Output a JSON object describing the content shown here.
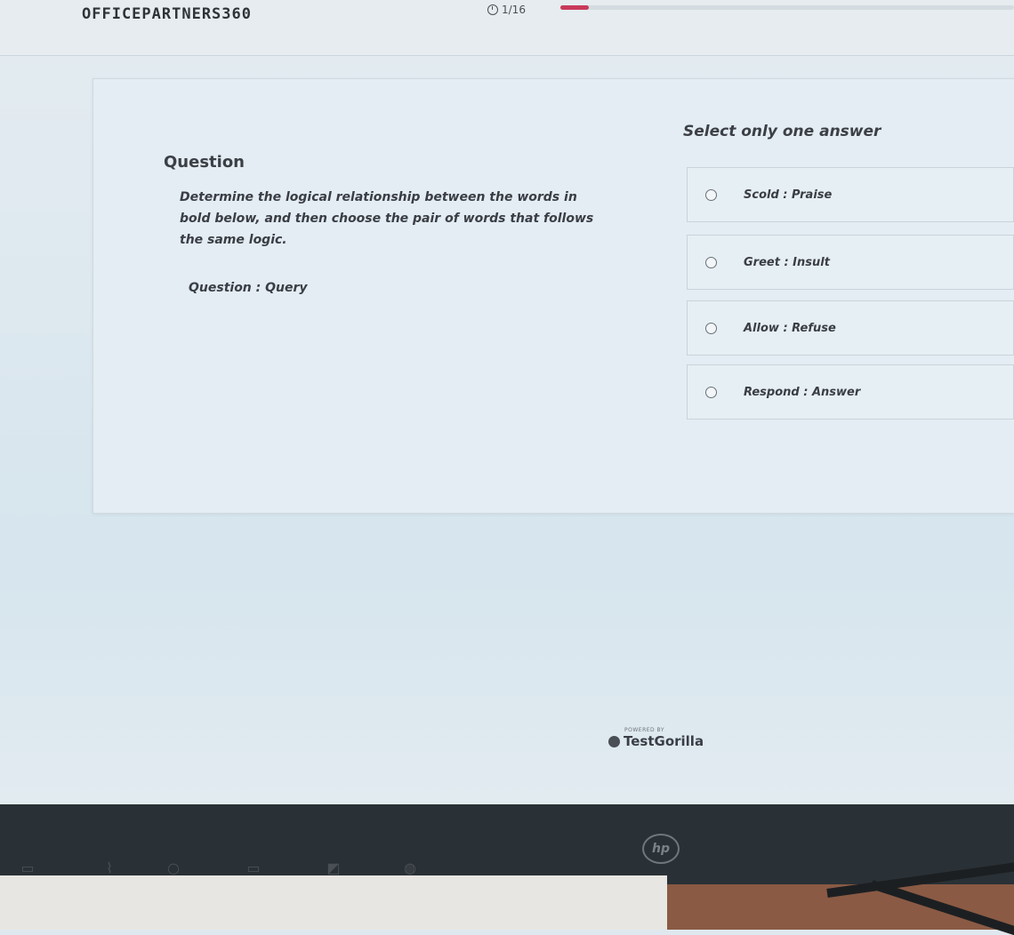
{
  "header": {
    "brand": "OFFICEPARTNERS360",
    "progress_text": "1/16",
    "progress_fraction": 0.0625,
    "accent_color": "#c93a5a",
    "clock_icon": "clock-icon"
  },
  "question": {
    "heading": "Question",
    "text": "Determine the logical relationship between the words in bold below, and then choose the pair of words that follows the same logic.",
    "words": "Question : Query"
  },
  "answers": {
    "heading": "Select only one answer",
    "options": [
      {
        "label": "Scold : Praise"
      },
      {
        "label": "Greet : Insult"
      },
      {
        "label": "Allow : Refuse"
      },
      {
        "label": "Respond : Answer"
      }
    ]
  },
  "footer": {
    "powered_by": "POWERED BY",
    "provider": "TestGorilla",
    "logo_icon": "testgorilla-logo-icon"
  },
  "monitor": {
    "logo_icon": "hp-logo-icon"
  }
}
